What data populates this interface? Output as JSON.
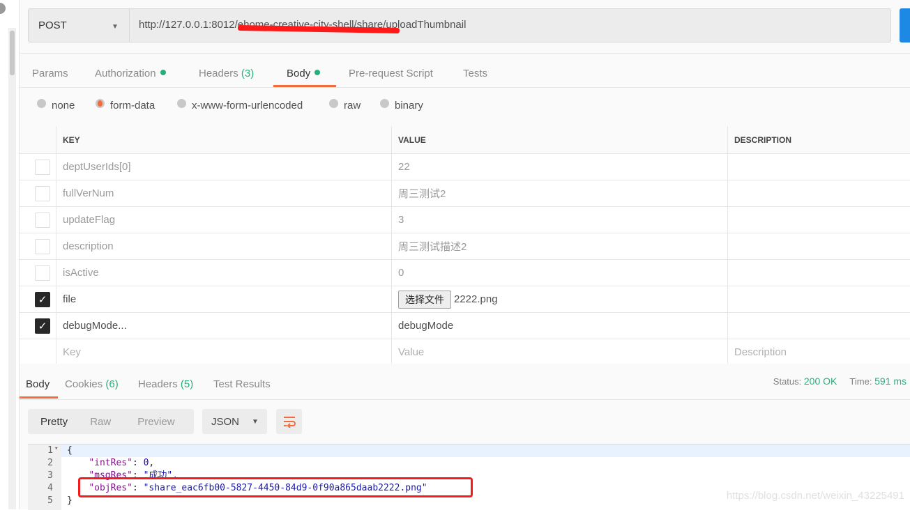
{
  "request": {
    "method": "POST",
    "url": "http://127.0.0.1:8012/ehome-creative-city-shell/share/uploadThumbnail"
  },
  "tabs": [
    {
      "label": "Params"
    },
    {
      "label": "Authorization",
      "dot": true
    },
    {
      "label": "Headers",
      "count": "(3)"
    },
    {
      "label": "Body",
      "dot": true,
      "active": true
    },
    {
      "label": "Pre-request Script"
    },
    {
      "label": "Tests"
    }
  ],
  "body_modes": [
    {
      "label": "none"
    },
    {
      "label": "form-data",
      "selected": true
    },
    {
      "label": "x-www-form-urlencoded"
    },
    {
      "label": "raw"
    },
    {
      "label": "binary"
    }
  ],
  "table": {
    "headers": [
      "KEY",
      "VALUE",
      "DESCRIPTION"
    ],
    "rows": [
      {
        "key": "deptUserIds[0]",
        "value": "22",
        "checked": false
      },
      {
        "key": "fullVerNum",
        "value": "周三测试2",
        "checked": false
      },
      {
        "key": "updateFlag",
        "value": "3",
        "checked": false
      },
      {
        "key": "description",
        "value": "周三测试描述2",
        "checked": false
      },
      {
        "key": "isActive",
        "value": "0",
        "checked": false
      },
      {
        "key": "file",
        "file_button": "选择文件",
        "value": "2222.png",
        "checked": true
      },
      {
        "key": "debugMode...",
        "value": "debugMode",
        "checked": true
      }
    ],
    "placeholder": {
      "key": "Key",
      "value": "Value",
      "description": "Description"
    }
  },
  "response": {
    "tabs": [
      {
        "label": "Body"
      },
      {
        "label": "Cookies",
        "count": "(6)"
      },
      {
        "label": "Headers",
        "count": "(5)"
      },
      {
        "label": "Test Results"
      }
    ],
    "status_label": "Status:",
    "status": "200 OK",
    "time_label": "Time:",
    "time": "591 ms",
    "views": [
      "Pretty",
      "Raw",
      "Preview"
    ],
    "format": "JSON",
    "lines": [
      {
        "n": "1",
        "text": "{"
      },
      {
        "n": "2",
        "key": "\"intRes\"",
        "val": "0",
        "type": "n",
        "comma": ","
      },
      {
        "n": "3",
        "key": "\"msgRes\"",
        "val": "\"成功\"",
        "type": "s",
        "comma": ","
      },
      {
        "n": "4",
        "key": "\"objRes\"",
        "val": "\"share_eac6fb00-5827-4450-84d9-0f90a865daab2222.png\"",
        "type": "s",
        "comma": ""
      },
      {
        "n": "5",
        "text": "}"
      }
    ]
  },
  "watermark": "https://blog.csdn.net/weixin_43225491",
  "colors": {
    "accent": "#f26b3a",
    "green": "#27b07b",
    "send": "#1d89e4",
    "highlight_box": "#f31b1b"
  }
}
